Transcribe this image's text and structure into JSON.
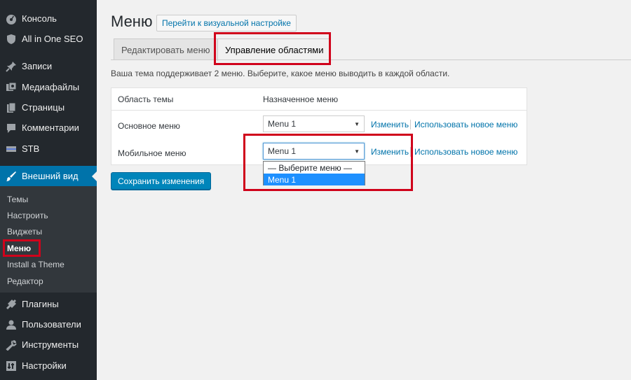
{
  "sidebar": {
    "items": [
      {
        "label": "Консоль",
        "icon": "dashboard-icon"
      },
      {
        "label": "All in One SEO",
        "icon": "shield-icon"
      },
      {
        "label": "Записи",
        "icon": "pin-icon"
      },
      {
        "label": "Медиафайлы",
        "icon": "media-icon"
      },
      {
        "label": "Страницы",
        "icon": "pages-icon"
      },
      {
        "label": "Комментарии",
        "icon": "comment-icon"
      },
      {
        "label": "STB",
        "icon": "stb-icon"
      },
      {
        "label": "Внешний вид",
        "icon": "brush-icon"
      },
      {
        "label": "Плагины",
        "icon": "plug-icon"
      },
      {
        "label": "Пользователи",
        "icon": "user-icon"
      },
      {
        "label": "Инструменты",
        "icon": "wrench-icon"
      },
      {
        "label": "Настройки",
        "icon": "settings-icon"
      }
    ],
    "submenu": [
      "Темы",
      "Настроить",
      "Виджеты",
      "Меню",
      "Install a Theme",
      "Редактор"
    ]
  },
  "header": {
    "title": "Меню",
    "visual_button": "Перейти к визуальной настройке"
  },
  "tabs": [
    "Редактировать меню",
    "Управление областями"
  ],
  "description": "Ваша тема поддерживает 2 меню. Выберите, какое меню выводить в каждой области.",
  "table": {
    "col_area": "Область темы",
    "col_menu": "Назначенное меню",
    "rows": [
      {
        "area": "Основное меню",
        "menu": "Menu 1",
        "edit": "Изменить",
        "new": "Использовать новое меню"
      },
      {
        "area": "Мобильное меню",
        "menu": "Menu 1",
        "edit": "Изменить",
        "new": "Использовать новое меню"
      }
    ]
  },
  "dropdown": {
    "options": [
      "— Выберите меню —",
      "Menu 1"
    ],
    "selected": "Menu 1"
  },
  "save_button": "Сохранить изменения",
  "colors": {
    "sidebar_bg": "#23282d",
    "accent": "#0073aa",
    "highlight": "#d0021b"
  }
}
